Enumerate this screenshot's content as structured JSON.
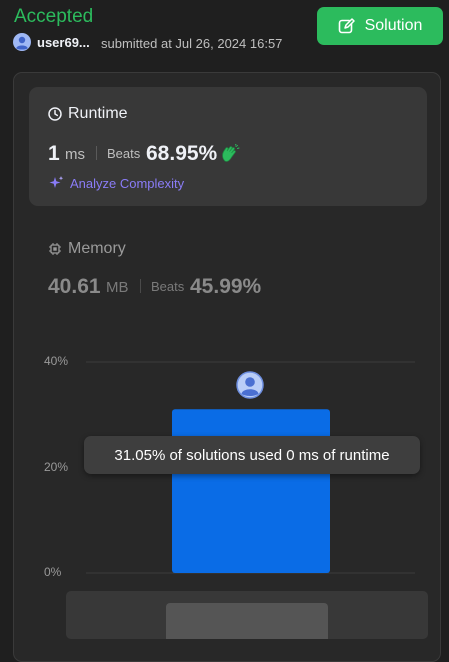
{
  "header": {
    "status": "Accepted",
    "username": "user69...",
    "submitted_text": "submitted at Jul 26, 2024 16:57",
    "solution_button": "Solution"
  },
  "runtime": {
    "title": "Runtime",
    "value": "1",
    "unit": "ms",
    "beats_label": "Beats",
    "beats_value": "68.95%",
    "analyze_label": "Analyze Complexity",
    "icon": "clock-icon",
    "badge_icon": "clap-icon"
  },
  "memory": {
    "title": "Memory",
    "value": "40.61",
    "unit": "MB",
    "beats_label": "Beats",
    "beats_value": "45.99%",
    "icon": "chip-icon"
  },
  "chart_data": {
    "type": "bar",
    "categories": [
      "0 ms"
    ],
    "values": [
      31.05
    ],
    "ylim": [
      0,
      40
    ],
    "y_ticks": [
      "0%",
      "20%",
      "40%"
    ],
    "grid": true,
    "highlighted_category": "0 ms",
    "tooltip": "31.05% of solutions used 0 ms of runtime"
  },
  "colors": {
    "accent_green": "#2cbb5d",
    "bar_blue": "#0a6ce6",
    "analyze_purple": "#8a7cf7"
  }
}
